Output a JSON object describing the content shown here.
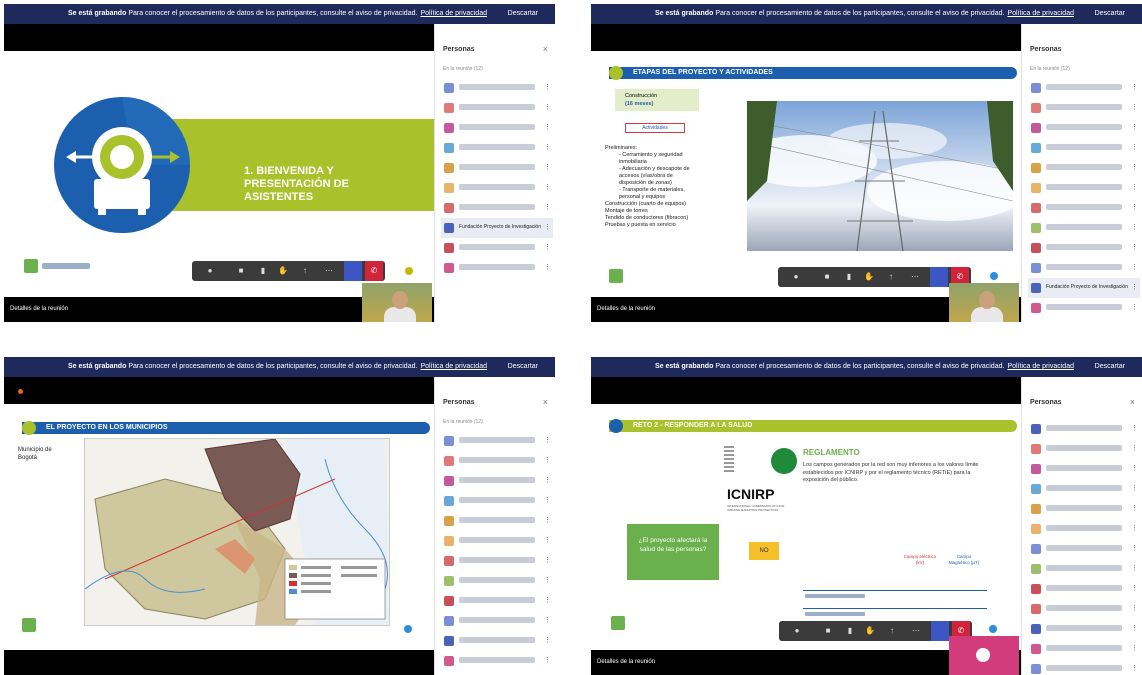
{
  "meeting": {
    "banner_bold": "Se está grabando",
    "banner_text": "Para conocer el procesamiento de datos de los participantes, consulte el aviso de privacidad.",
    "banner_link": "Política de privacidad",
    "dismiss_label": "Descartar",
    "participants_title": "Personas",
    "participants_close": "×",
    "panel_subtitle": "En la reunión (12)",
    "bottom_label": "Detalles de la reunión",
    "highlight_name": "Fundación Proyecto de Investigación"
  },
  "slides": {
    "q1_title": "1. BIENVENIDA Y PRESENTACIÓN DE ASISTENTES",
    "q2_heading": "ETAPAS DEL PROYECTO Y ACTIVIDADES",
    "q2_box1": "Construcción",
    "q2_box2": "(16 meses)",
    "q2_box3": "Actividades",
    "q2_bullets": [
      "Preliminares:",
      "- Cerramiento y seguridad",
      "  inmobiliaria",
      "- Adecuación y descapote de",
      "  accesos (vías/obra de",
      "  disposición de zonas)",
      "- Transporte de materiales,",
      "  personal y equipos",
      "Construcción (cuarto de equipos)",
      "Montaje de torres",
      "Tendido de conductores (fibracon)",
      "Pruebas y puesta en servicio"
    ],
    "q3_heading": "EL PROYECTO EN LOS MUNICIPIOS",
    "q3_text1": "Municipio de",
    "q3_text2": "Bogotá",
    "q4_heading": "RETO 2 - RESPONDER A LA SALUD",
    "q4_icnirp": "ICNIRP",
    "q4_icnirp_sub": "INTERNATIONAL COMMISSION ON NON-IONIZING RADIATION PROTECTION",
    "q4_green_box": "¿El proyecto afectará la salud de las personas?",
    "q4_yellow": "NO",
    "q4_section": "REGLAMENTO",
    "q4_paragraph": "Los campos generados por la red son muy inferiores a los valores límite establecidos por ICNIRP y por el reglamento técnico (RETIE) para la exposición del público.",
    "q4_table_headers": [
      "Campo eléctrico (kV)",
      "Campo Magnético (µT)"
    ]
  },
  "colors": {
    "banner": "#1e2a5c",
    "accent_green": "#a9c12b",
    "accent_blue": "#1b5fae",
    "end_call_red": "#d1243b"
  },
  "icons": [
    "mic-icon",
    "camera-icon",
    "hand-icon",
    "share-icon",
    "more-icon",
    "end-call-icon",
    "close-icon"
  ]
}
